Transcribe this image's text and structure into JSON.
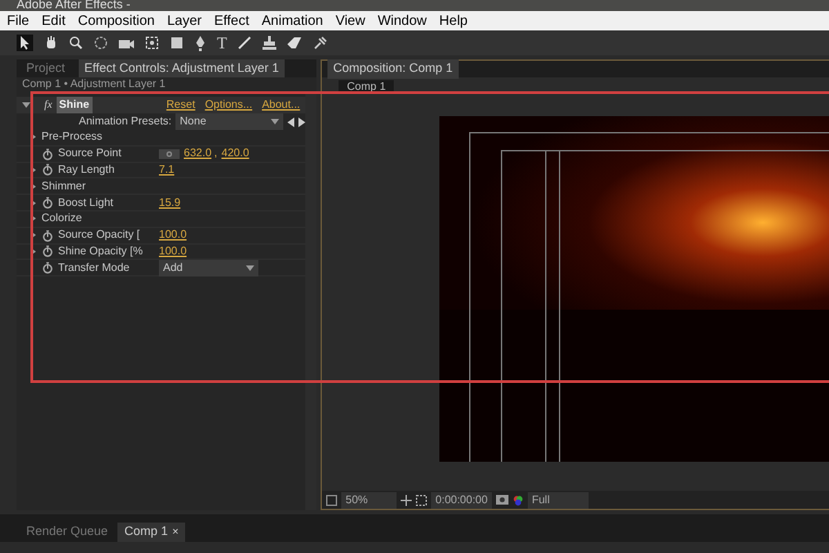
{
  "window": {
    "title": "Adobe After Effects -"
  },
  "tools": {
    "type_tool": "T"
  },
  "menu": [
    "File",
    "Edit",
    "Composition",
    "Layer",
    "Effect",
    "Animation",
    "View",
    "Window",
    "Help"
  ],
  "left_tabs": [
    {
      "label": "Project",
      "selected": false
    },
    {
      "label": "Effect Controls: Adjustment Layer 1",
      "selected": true
    }
  ],
  "breadcrumb": "Comp 1 • Adjustment Layer 1",
  "effect": {
    "fx": "fx",
    "name": "Shine",
    "links": [
      "Reset",
      "Options...",
      "About..."
    ],
    "presets_label": "Animation Presets:",
    "presets_value": "None",
    "props": [
      {
        "kind": "group",
        "label": "Pre-Process",
        "twirl": true
      },
      {
        "kind": "point",
        "label": "Source Point",
        "twirl": false,
        "values": [
          "632.0",
          "420.0"
        ],
        "separator": ","
      },
      {
        "kind": "value",
        "label": "Ray Length",
        "twirl": true,
        "value": "7.1"
      },
      {
        "kind": "group",
        "label": "Shimmer",
        "twirl": true
      },
      {
        "kind": "value",
        "label": "Boost Light",
        "twirl": true,
        "value": "15.9"
      },
      {
        "kind": "group",
        "label": "Colorize",
        "twirl": true
      },
      {
        "kind": "value",
        "label": "Source Opacity [",
        "twirl": true,
        "value": "100.0"
      },
      {
        "kind": "value",
        "label": "Shine Opacity [%",
        "twirl": true,
        "value": "100.0"
      },
      {
        "kind": "dropdown",
        "label": "Transfer Mode",
        "twirl": false,
        "value": "Add"
      }
    ]
  },
  "comp_panel": {
    "tab": "Composition: Comp 1",
    "subtab": "Comp 1",
    "zoom": "50%",
    "timecode": "0:00:00:00",
    "resolution": "Full"
  },
  "bottom_tabs": [
    {
      "label": "Render Queue",
      "selected": false
    },
    {
      "label": "Comp 1",
      "selected": true,
      "close": "×"
    }
  ]
}
